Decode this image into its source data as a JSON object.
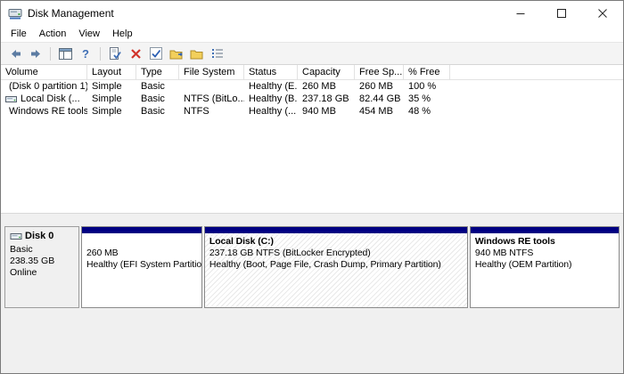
{
  "window": {
    "title": "Disk Management"
  },
  "menu": {
    "items": [
      "File",
      "Action",
      "View",
      "Help"
    ]
  },
  "toolbar": {
    "icons": [
      "back",
      "forward",
      "show-console-tree",
      "help",
      "properties",
      "delete",
      "verify",
      "new-folder",
      "folder",
      "details-view"
    ]
  },
  "volumes": {
    "columns": [
      "Volume",
      "Layout",
      "Type",
      "File System",
      "Status",
      "Capacity",
      "Free Sp...",
      "% Free"
    ],
    "rows": [
      {
        "volume": "(Disk 0 partition 1)",
        "layout": "Simple",
        "type": "Basic",
        "file_system": "",
        "status": "Healthy (E...",
        "capacity": "260 MB",
        "free_space": "260 MB",
        "pct_free": "100 %"
      },
      {
        "volume": "Local Disk (...",
        "layout": "Simple",
        "type": "Basic",
        "file_system": "NTFS (BitLo...",
        "status": "Healthy (B...",
        "capacity": "237.18 GB",
        "free_space": "82.44 GB",
        "pct_free": "35 %"
      },
      {
        "volume": "Windows RE tools",
        "layout": "Simple",
        "type": "Basic",
        "file_system": "NTFS",
        "status": "Healthy (...",
        "capacity": "940 MB",
        "free_space": "454 MB",
        "pct_free": "48 %"
      }
    ]
  },
  "disk0": {
    "label": "Disk 0",
    "type": "Basic",
    "capacity": "238.35 GB",
    "status": "Online",
    "partitions": [
      {
        "title": "",
        "line1": "260 MB",
        "line2": "Healthy (EFI System Partition)"
      },
      {
        "title": "Local Disk  (C:)",
        "line1": "237.18 GB NTFS (BitLocker Encrypted)",
        "line2": "Healthy (Boot, Page File, Crash Dump, Primary Partition)"
      },
      {
        "title": "Windows RE tools",
        "line1": "940 MB NTFS",
        "line2": "Healthy (OEM Partition)"
      }
    ]
  },
  "colors": {
    "partition_bar": "#000082",
    "delete_icon_red": "#d1342b",
    "toolbar_blue": "#3f6fb5",
    "folder_yellow": "#f2cf5b"
  }
}
